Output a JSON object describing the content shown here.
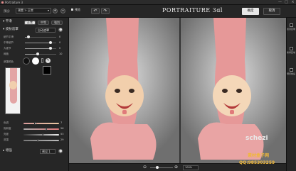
{
  "window": {
    "title": "Portraiture 3",
    "minimize": "—",
    "maximize": "□",
    "close": "×"
  },
  "topbar": {
    "preset_label": "预设:",
    "preset_value": "预置 > 正常",
    "add_button": "+",
    "remove_button": "−",
    "preview_label": "预览",
    "undo_icon": "↶",
    "redo_icon": "↷",
    "logo": "PORTRAITURE 3ɑl",
    "ok_label": "确定",
    "cancel_label": "取消"
  },
  "left": {
    "section_smooth": "平滑",
    "modes": [
      "正常",
      "中等",
      "强烈"
    ],
    "section_mask": "皮肤遮罩",
    "mask_preset": "自动遮罩",
    "sliders": [
      {
        "label": "细节平滑",
        "value": "0",
        "pos": 0.12
      },
      {
        "label": "中等细节",
        "value": "0",
        "pos": 0.82
      },
      {
        "label": "大细节",
        "value": "0",
        "pos": 0.82
      },
      {
        "label": "阈值",
        "value": "10",
        "pos": 0.4
      }
    ],
    "mask_color_label": "遮罩颜色",
    "tones": [
      {
        "label": "色调",
        "value": "7",
        "pos": 0.32,
        "colors": [
          "#d89a9a",
          "#e8c6a0"
        ]
      },
      {
        "label": "饱和度",
        "value": "56",
        "pos": 0.62,
        "colors": [
          "#aaaaaa",
          "#e07a7a"
        ]
      },
      {
        "label": "亮度",
        "value": "53",
        "pos": 0.55,
        "colors": [
          "#333333",
          "#eeeeee"
        ]
      },
      {
        "label": "范围",
        "value": "29",
        "pos": 0.4,
        "colors": [
          "#777777",
          "#bbbbbb"
        ]
      }
    ],
    "section_enhance": "增强",
    "enhance_dropdown": "预设 1"
  },
  "right": {
    "items": [
      {
        "label": "遮罩区域",
        "checked": false
      },
      {
        "label": "修饰区域",
        "checked": false
      },
      {
        "label": "预览前后",
        "checked": true
      }
    ]
  },
  "bottom": {
    "zoom": "100%"
  },
  "watermark": {
    "site": "schezi",
    "cn": "素材盒子网",
    "qq": "QQ:985303259"
  }
}
